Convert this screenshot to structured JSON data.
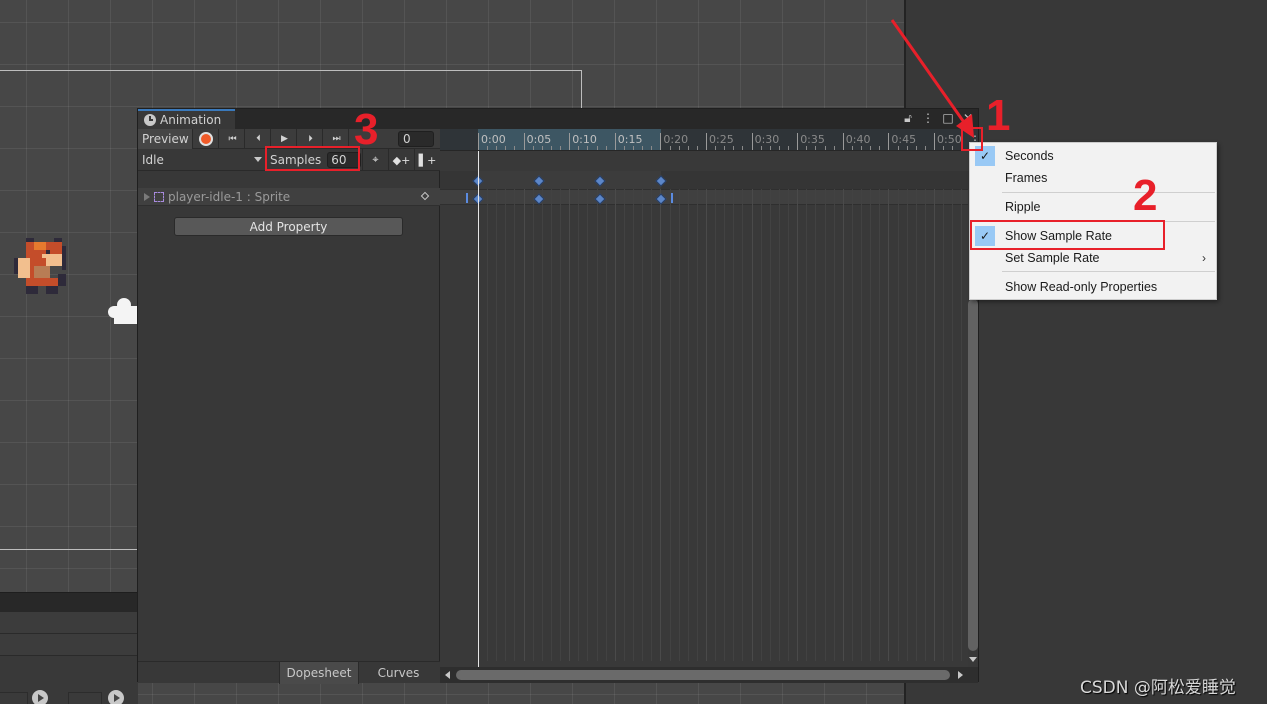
{
  "window": {
    "tab_title": "Animation",
    "tab_icons": [
      "lock-icon",
      "kebab-menu-icon",
      "maximize-icon",
      "close-icon"
    ]
  },
  "toolbar": {
    "preview_label": "Preview",
    "record_icon": "record-icon",
    "nav_icons": [
      "first-key-icon",
      "prev-key-icon",
      "play-icon",
      "next-key-icon",
      "last-key-icon"
    ],
    "frame_value": "0",
    "clip_name": "Idle",
    "samples_label": "Samples",
    "samples_value": "60",
    "tool_icons": [
      "snap-target-icon",
      "add-keyframe-icon",
      "add-event-icon"
    ]
  },
  "hierarchy": {
    "property_label": "player-idle-1 : Sprite",
    "add_property_label": "Add Property"
  },
  "bottom_tabs": {
    "dopesheet": "Dopesheet",
    "curves": "Curves",
    "active": "Dopesheet"
  },
  "timeline": {
    "ticks": [
      "0:00",
      "0:05",
      "0:10",
      "0:15",
      "0:20",
      "0:25",
      "0:30",
      "0:35",
      "0:40",
      "0:45",
      "0:50"
    ],
    "active_range_end": "0:20",
    "keyframes_frames": [
      0,
      5,
      10,
      15
    ]
  },
  "context_menu": {
    "items": [
      {
        "label": "Seconds",
        "checked": true,
        "submenu": false
      },
      {
        "label": "Frames",
        "checked": false,
        "submenu": false
      },
      {
        "label": "Ripple",
        "checked": false,
        "submenu": false
      },
      {
        "label": "Show Sample Rate",
        "checked": true,
        "submenu": false
      },
      {
        "label": "Set Sample Rate",
        "checked": false,
        "submenu": true
      },
      {
        "label": "Show Read-only Properties",
        "checked": false,
        "submenu": false
      }
    ]
  },
  "annotations": {
    "step1": "1",
    "step2": "2",
    "step3": "3",
    "color": "#e8202a"
  },
  "watermark": "CSDN @阿松爱睡觉"
}
